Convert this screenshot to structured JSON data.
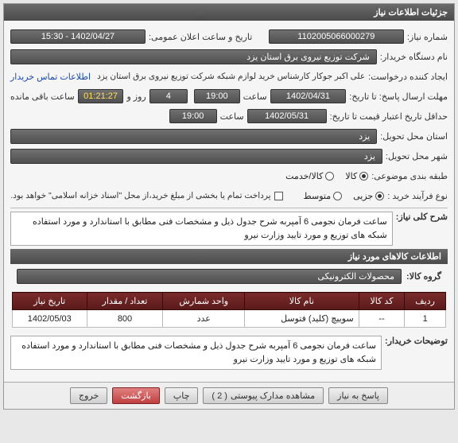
{
  "panel": {
    "title": "جزئیات اطلاعات نیاز"
  },
  "labels": {
    "need_no": "شماره نیاز:",
    "public_date": "تاریخ و ساعت اعلان عمومی:",
    "buyer_name": "نام دستگاه خریدار:",
    "creator": "ایجاد کننده درخواست:",
    "contact_link": "اطلاعات تماس خریدار",
    "reply_deadline": "مهلت ارسال پاسخ: تا تاریخ:",
    "time": "ساعت",
    "day_word": "روز و",
    "remaining": "ساعت باقی مانده",
    "min_valid": "حداقل تاریخ اعتبار قیمت تا تاریخ:",
    "province": "استان محل تحویل:",
    "city": "شهر محل تحویل:",
    "subject_cat": "طبقه بندی موضوعی:",
    "purchase_type": "نوع فرآیند خرید :",
    "full_desc": "شرح کلی نیاز:",
    "buyer_notes": "توضیحات خریدار:"
  },
  "vals": {
    "need_no": "1102005066000279",
    "pub_date": "1402/04/27 - 15:30",
    "buyer_name": "شرکت توزیع نیروی برق استان یزد",
    "creator_text": "علی اکبر جوکار  کارشناس خرید لوازم شبکه  شرکت توزیع نیروی برق استان یزد",
    "reply_date": "1402/04/31",
    "reply_time": "19:00",
    "days": "4",
    "remaining_time": "01:21:27",
    "minvalid_date": "1402/05/31",
    "minvalid_time": "19:00",
    "province": "یزد",
    "city": "یزد",
    "pay_note": "پرداخت تمام یا بخشی از مبلغ خرید،از محل \"اسناد خزانه اسلامی\" خواهد بود.",
    "full_desc": "ساعت فرمان نجومی 6 آمپربه شرح جدول ذیل و مشخصات فنی مطابق با استاندارد و مورد استفاده شبکه های توزیع و مورد تایید وزارت نیرو"
  },
  "subject_opts": {
    "goods": "کالا",
    "service": "کالا/خدمت"
  },
  "purchase_opts": {
    "minor": "جزیی",
    "medium": "متوسط"
  },
  "items_section": {
    "title": "اطلاعات کالاهای مورد نیاز",
    "group_label": "گروه کالا:",
    "group_value": "محصولات الکترونیکی"
  },
  "table": {
    "headers": {
      "row": "ردیف",
      "code": "کد کالا",
      "name": "نام کالا",
      "unit": "واحد شمارش",
      "qty": "تعداد / مقدار",
      "date": "تاریخ نیاز"
    },
    "rows": [
      {
        "row": "1",
        "code": "--",
        "name": "سوییچ (کلید) فتوسل",
        "unit": "عدد",
        "qty": "800",
        "date": "1402/05/03"
      }
    ]
  },
  "notes_box": "ساعت فرمان نجومی 6 آمپربه شرح جدول ذیل و مشخصات فنی مطابق با استاندارد و مورد استفاده شبکه های توزیع و مورد تایید وزارت نیرو",
  "buttons": {
    "reply": "پاسخ به نیاز",
    "view_attach": "مشاهده مدارک پیوستی",
    "attach_count": "( 2 )",
    "print": "چاپ",
    "back": "بازگشت",
    "exit": "خروج"
  }
}
